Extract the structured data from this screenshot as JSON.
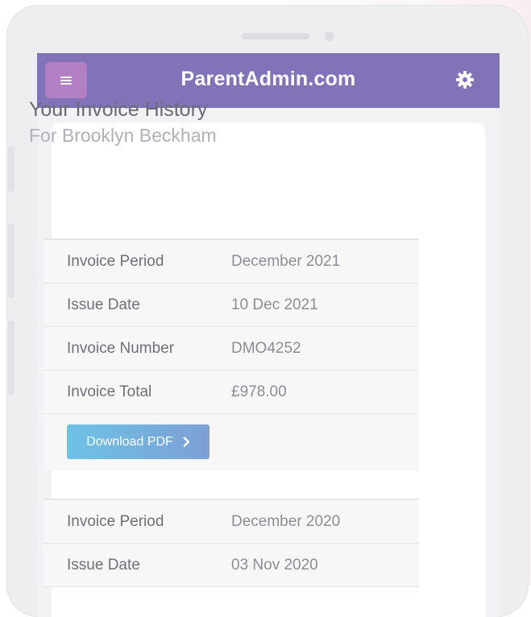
{
  "app": {
    "title": "ParentAdmin.com",
    "accent_color": "#8272b8",
    "menu_button_color": "#b27fc4",
    "menu_icon": "hamburger-menu-icon",
    "settings_icon": "gear-icon"
  },
  "page": {
    "title": "Your Invoice History",
    "subtitle": "For Brooklyn Beckham"
  },
  "invoices": [
    {
      "rows": [
        {
          "label": "Invoice Period",
          "value": "December 2021"
        },
        {
          "label": "Issue Date",
          "value": "10 Dec 2021"
        },
        {
          "label": "Invoice Number",
          "value": "DMO4252"
        },
        {
          "label": "Invoice Total",
          "value": "£978.00"
        }
      ],
      "download_label": "Download PDF",
      "download_icon": "chevron-right-icon"
    },
    {
      "rows": [
        {
          "label": "Invoice Period",
          "value": "December 2020"
        },
        {
          "label": "Issue Date",
          "value": "03 Nov 2020"
        }
      ]
    }
  ]
}
